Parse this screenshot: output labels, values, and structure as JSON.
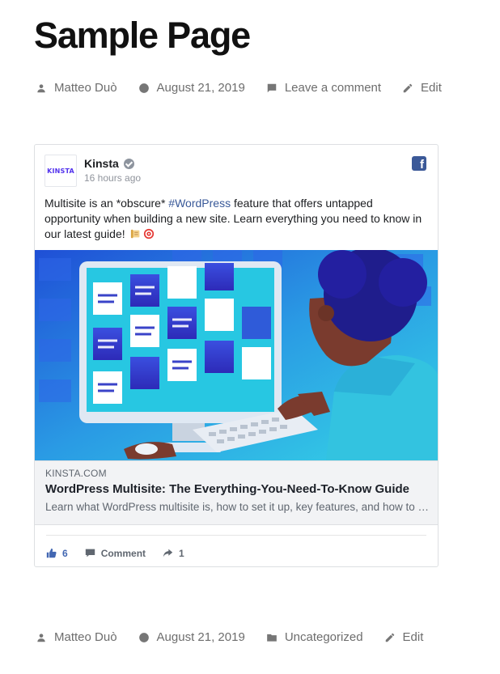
{
  "page": {
    "title": "Sample Page"
  },
  "meta_top": {
    "author": "Matteo Duò",
    "date": "August 21, 2019",
    "comment": "Leave a comment",
    "edit": "Edit"
  },
  "meta_bottom": {
    "author": "Matteo Duò",
    "date": "August 21, 2019",
    "category": "Uncategorized",
    "edit": "Edit"
  },
  "fb_post": {
    "avatar_text": "KINSTA",
    "page_name": "Kinsta",
    "time": "16 hours ago",
    "text_before": "Multisite is an *obscure* ",
    "hashtag": "#WordPress",
    "text_after": " feature that offers untapped opportunity when building a new site. Learn everything you need to know in our latest guide!",
    "link": {
      "domain": "KINSTA.COM",
      "title": "WordPress Multisite: The Everything-You-Need-To-Know Guide",
      "description": "Learn what WordPress multisite is, how to set it up, key features, and how to manage your network of sites."
    },
    "actions": {
      "likes": "6",
      "comment_label": "Comment",
      "shares": "1"
    },
    "colors": {
      "facebook_blue": "#3b5998",
      "like_blue": "#4267b2",
      "hashtag": "#385898"
    }
  }
}
